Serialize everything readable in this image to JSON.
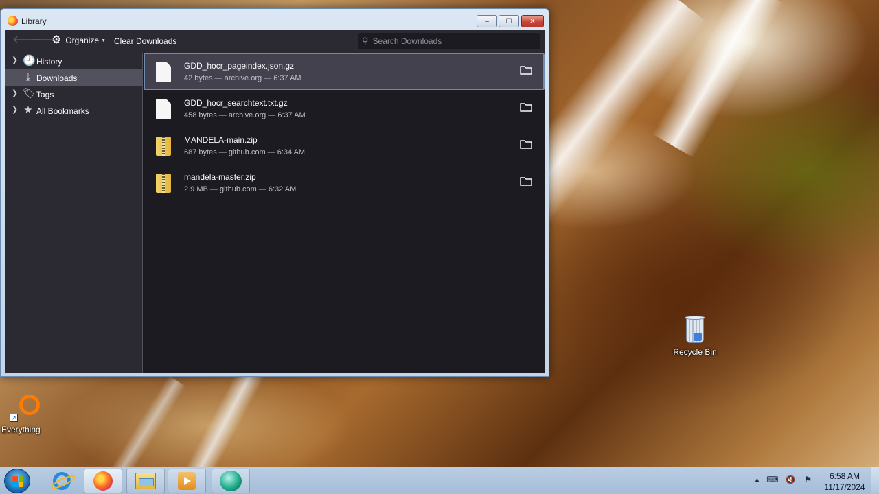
{
  "window": {
    "title": "Library",
    "controls": {
      "minimize": "‒",
      "maximize": "☐",
      "close": "✕"
    }
  },
  "toolbar": {
    "back_icon": "arrow-left-icon",
    "forward_icon": "arrow-right-icon",
    "organize_label": "Organize",
    "clear_label": "Clear Downloads",
    "search_placeholder": "Search Downloads",
    "search_value": ""
  },
  "sidebar": {
    "items": [
      {
        "label": "History",
        "icon": "clock-icon",
        "expandable": true,
        "selected": false
      },
      {
        "label": "Downloads",
        "icon": "download-icon",
        "expandable": false,
        "selected": true
      },
      {
        "label": "Tags",
        "icon": "tag-icon",
        "expandable": true,
        "selected": false
      },
      {
        "label": "All Bookmarks",
        "icon": "star-icon",
        "expandable": true,
        "selected": false
      }
    ]
  },
  "downloads": [
    {
      "name": "GDD_hocr_pageindex.json.gz",
      "meta": "42 bytes — archive.org — 6:37 AM",
      "icon": "document-icon",
      "selected": true
    },
    {
      "name": "GDD_hocr_searchtext.txt.gz",
      "meta": "458 bytes — archive.org — 6:37 AM",
      "icon": "document-icon",
      "selected": false
    },
    {
      "name": "MANDELA-main.zip",
      "meta": "687 bytes — github.com — 6:34 AM",
      "icon": "zip-icon",
      "selected": false
    },
    {
      "name": "mandela-master.zip",
      "meta": "2.9 MB — github.com — 6:32 AM",
      "icon": "zip-icon",
      "selected": false
    }
  ],
  "desktop": {
    "recycle_bin": "Recycle Bin",
    "everything": "Everything"
  },
  "taskbar": {
    "clock_time": "6:58 AM",
    "clock_date": "11/17/2024"
  },
  "colors": {
    "window_bg": "#1c1b22",
    "toolbar_bg": "#2b2a33",
    "selected_row": "#42414d",
    "text": "#fbfbfe",
    "muted_text": "#bfbfc9"
  }
}
